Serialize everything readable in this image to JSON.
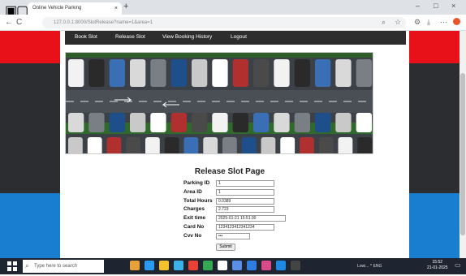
{
  "browser": {
    "tab_title": "Online Vehicle Parking",
    "tab_close": "×",
    "new_tab": "+",
    "url": "127.0.0.1:8000/SlotRelease?name=1&area=1",
    "back": "←",
    "forward": "→",
    "reload": "C",
    "window_minimize": "–",
    "window_maximize": "□",
    "window_close": "×"
  },
  "nav": {
    "items": [
      "Book Slot",
      "Release Slot",
      "View Booking History",
      "Logout"
    ]
  },
  "form": {
    "title": "Release Slot Page",
    "fields": [
      {
        "label": "Parking ID",
        "value": "1"
      },
      {
        "label": "Area ID",
        "value": "1"
      },
      {
        "label": "Total Hours",
        "value": "0.0389"
      },
      {
        "label": "Charges",
        "value": "2.723"
      },
      {
        "label": "Exit time",
        "value": "2025-01-21 15:51:30"
      },
      {
        "label": "Card No",
        "value": "1234123412341234"
      },
      {
        "label": "Cvv No",
        "value": "•••"
      }
    ],
    "submit_label": "Submit"
  },
  "taskbar": {
    "search_placeholder": "Type here to search",
    "tray": "Lowi...  ^  ENG",
    "time": "15:52",
    "date": "21-01-2025"
  },
  "colors": {
    "red": "#e8111a",
    "dark": "#2b2d30",
    "blue": "#1a7ed0",
    "navbar": "#2d2d2d"
  }
}
